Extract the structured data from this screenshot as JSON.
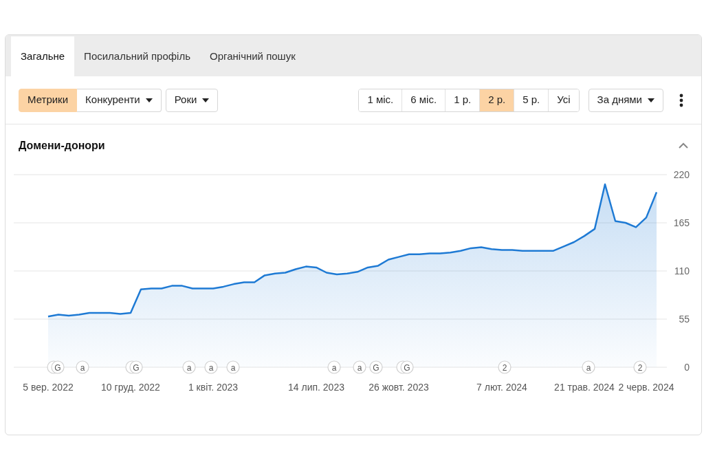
{
  "tabs": [
    {
      "label": "Загальне",
      "selected": true
    },
    {
      "label": "Посилальний профіль",
      "selected": false
    },
    {
      "label": "Органічний пошук",
      "selected": false
    }
  ],
  "toolbar": {
    "view_buttons": [
      {
        "label": "Метрики",
        "selected": true,
        "dropdown": false
      },
      {
        "label": "Конкуренти",
        "selected": false,
        "dropdown": true
      }
    ],
    "years_button": {
      "label": "Роки"
    },
    "ranges": [
      {
        "label": "1 міс.",
        "selected": false
      },
      {
        "label": "6 міс.",
        "selected": false
      },
      {
        "label": "1 р.",
        "selected": false
      },
      {
        "label": "2 р.",
        "selected": true
      },
      {
        "label": "5 р.",
        "selected": false
      },
      {
        "label": "Усі",
        "selected": false
      }
    ],
    "interval_button": {
      "label": "За днями"
    }
  },
  "panel": {
    "title": "Домени-донори",
    "expanded": true,
    "chart_data": {
      "type": "area",
      "categories": [
        "5 вер. 2022",
        null,
        null,
        null,
        null,
        null,
        null,
        null,
        "10 груд. 2022",
        null,
        null,
        null,
        null,
        null,
        null,
        null,
        "1 квіт. 2023",
        null,
        null,
        null,
        null,
        null,
        null,
        null,
        null,
        null,
        "14 лип. 2023",
        null,
        null,
        null,
        null,
        null,
        null,
        null,
        "26 жовт. 2023",
        null,
        null,
        null,
        null,
        null,
        null,
        null,
        null,
        null,
        "7 лют. 2024",
        null,
        null,
        null,
        null,
        null,
        null,
        null,
        "21 трав. 2024",
        null,
        null,
        null,
        null,
        null,
        "2 черв. 2024",
        null
      ],
      "series": [
        {
          "color": "#1e7ad4",
          "values": [
            58,
            60,
            59,
            60,
            62,
            62,
            62,
            61,
            62,
            89,
            90,
            90,
            93,
            93,
            90,
            90,
            90,
            92,
            95,
            97,
            97,
            105,
            107,
            108,
            112,
            115,
            114,
            108,
            106,
            107,
            109,
            114,
            116,
            123,
            126,
            129,
            129,
            130,
            130,
            131,
            133,
            136,
            137,
            135,
            134,
            134,
            133,
            133,
            133,
            133,
            138,
            143,
            150,
            158,
            209,
            167,
            165,
            160,
            171,
            200
          ]
        }
      ],
      "ylim": [
        0,
        220
      ],
      "yticks": [
        0,
        55,
        110,
        165,
        220
      ],
      "grid": true
    },
    "event_markers": [
      {
        "text": "G",
        "stacked": true
      },
      {
        "text": "a",
        "stacked": false
      },
      {
        "text": "G",
        "stacked": true
      },
      {
        "text": "a",
        "stacked": false
      },
      {
        "text": "a",
        "stacked": false
      },
      {
        "text": "a",
        "stacked": false
      },
      {
        "text": "a",
        "stacked": false
      },
      {
        "text": "a",
        "stacked": false
      },
      {
        "text": "G",
        "stacked": false
      },
      {
        "text": "G",
        "stacked": true
      },
      {
        "text": "2",
        "stacked": false
      },
      {
        "text": "a",
        "stacked": false
      },
      {
        "text": "2",
        "stacked": false
      }
    ]
  }
}
